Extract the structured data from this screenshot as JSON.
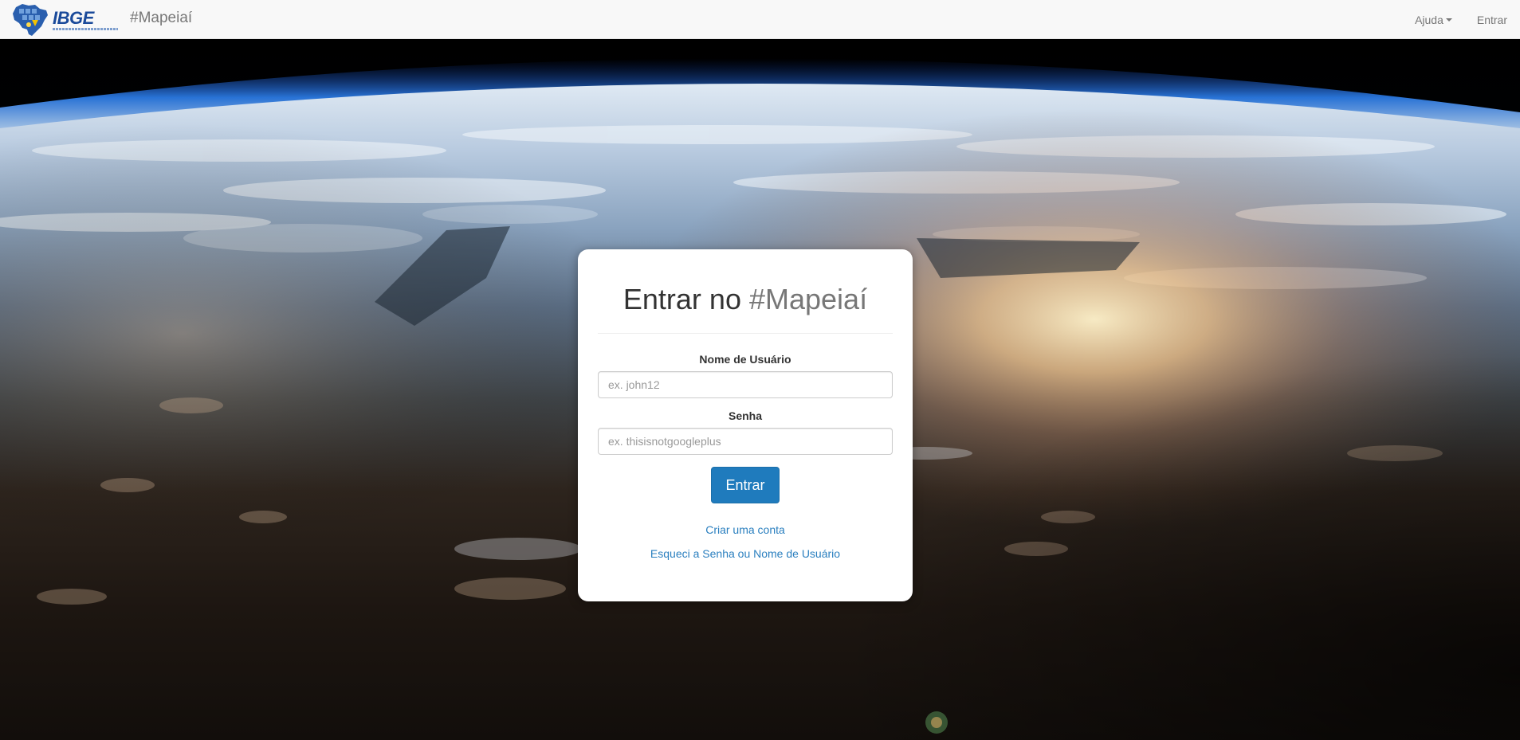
{
  "navbar": {
    "brand_text": "IBGE",
    "app_title": "#Mapeiaí",
    "menu": {
      "help_label": "Ajuda",
      "login_label": "Entrar"
    }
  },
  "login": {
    "title_prefix": "Entrar no",
    "title_highlight": "#Mapeiaí",
    "username": {
      "label": "Nome de Usuário",
      "placeholder": "ex. john12",
      "value": ""
    },
    "password": {
      "label": "Senha",
      "placeholder": "ex. thisisnotgoogleplus",
      "value": ""
    },
    "submit_label": "Entrar",
    "create_account_link": "Criar uma conta",
    "forgot_link": "Esqueci a Senha ou Nome de Usuário"
  },
  "colors": {
    "primary": "#1f7bbd",
    "link": "#2a7fbf",
    "brand_blue": "#1a4a9a",
    "navbar_bg": "#f8f8f8"
  },
  "icons": {
    "brand_logo": "brazil-map-logo-icon",
    "dropdown": "caret-down-icon"
  }
}
